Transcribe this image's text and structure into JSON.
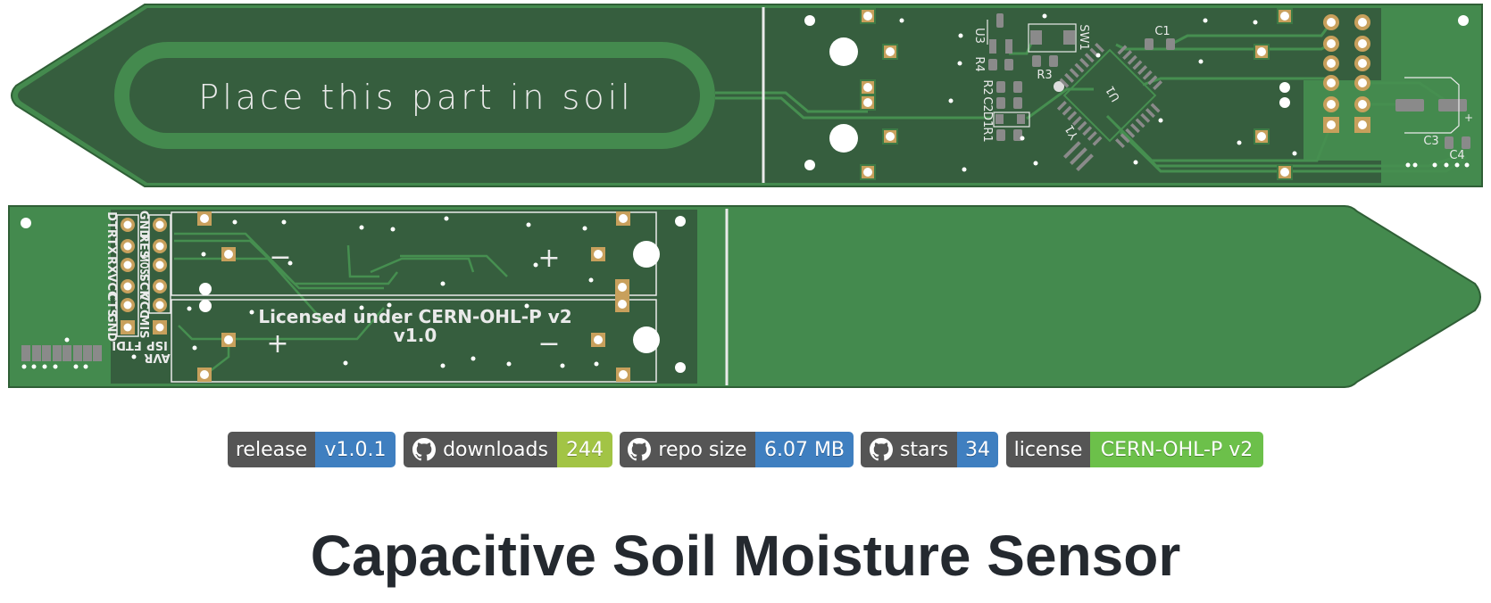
{
  "pcb": {
    "front_text": "Place this part in soil",
    "license_text": "Licensed under CERN-OHL-P v2",
    "version_text": "v1.0",
    "plus": "+",
    "minus": "−",
    "refs": {
      "u3": "U3",
      "r4": "R4",
      "sw1": "SW1",
      "r3": "R3",
      "c1": "C1",
      "r2": "R2",
      "c2": "C2",
      "d1": "D1",
      "r1": "R1",
      "u1": "U1",
      "y1": "Y1",
      "c3": "C3",
      "c4": "C4"
    },
    "ftdi_pins": [
      "DTR",
      "TX",
      "RX",
      "VCC",
      "CTS",
      "GND"
    ],
    "isp_pins": [
      "GND",
      "RES",
      "MOSI",
      "SCK",
      "VCC",
      "MIS"
    ],
    "ftdi_label": "FTDI",
    "isp_label_1": "ISP",
    "isp_label_2": "AVR",
    "colors": {
      "board": "#448a4e",
      "pour": "#365e3e",
      "copper": "#c8a05c",
      "silk": "#eaeaea",
      "pad_smd": "#8a8a8a"
    }
  },
  "badges": [
    {
      "label": "release",
      "value": "v1.0.1",
      "color": "#3f7fc0",
      "icon": null
    },
    {
      "label": "downloads",
      "value": "244",
      "color": "#a2c445",
      "icon": "github-icon"
    },
    {
      "label": "repo size",
      "value": "6.07 MB",
      "color": "#3f7fc0",
      "icon": "github-icon"
    },
    {
      "label": "stars",
      "value": "34",
      "color": "#3f7fc0",
      "icon": "github-icon"
    },
    {
      "label": "license",
      "value": "CERN-OHL-P v2",
      "color": "#6cc04a",
      "icon": null
    }
  ],
  "title": "Capacitive Soil Moisture Sensor"
}
